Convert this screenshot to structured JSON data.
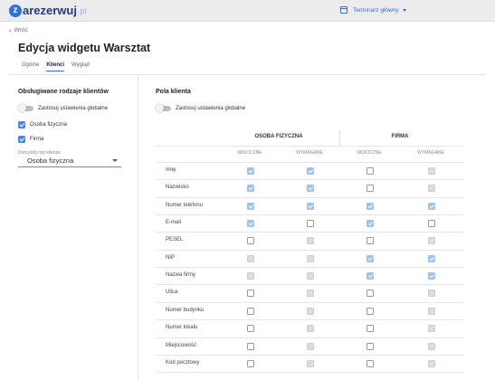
{
  "header": {
    "logo_letter": "z",
    "logo_text": "arezerwuj",
    "logo_tld": ".pl",
    "calendar_label": "Terminarz główny"
  },
  "back_label": "Wróć",
  "page_title": "Edycja widgetu Warsztat",
  "tabs": [
    {
      "label": "Ogólne",
      "active": false
    },
    {
      "label": "Klienci",
      "active": true
    },
    {
      "label": "Wygląd",
      "active": false
    }
  ],
  "left_panel": {
    "heading": "Obsługiwane rodzaje klientów",
    "global_toggle_label": "Zastosuj ustawienia globalne",
    "global_toggle_on": false,
    "client_types": [
      {
        "label": "Osoba fizyczna",
        "checked": true
      },
      {
        "label": "Firma",
        "checked": true
      }
    ],
    "default_type_label": "Domyślny typ klienta:",
    "default_type_value": "Osoba fizyczna"
  },
  "right_panel": {
    "heading": "Pola klienta",
    "global_toggle_label": "Zastosuj ustawienia globalne",
    "global_toggle_on": false,
    "groups": [
      "OSOBA FIZYCZNA",
      "FIRMA"
    ],
    "columns": [
      "WIDOCZNE",
      "WYMAGANE",
      "WIDOCZNE",
      "WYMAGANE"
    ],
    "rows": [
      {
        "label": "Imię",
        "states": [
          "dis-on",
          "dis-on",
          "off",
          "dis"
        ]
      },
      {
        "label": "Nazwisko",
        "states": [
          "dis-on",
          "dis-on",
          "off",
          "dis"
        ]
      },
      {
        "label": "Numer telefonu",
        "states": [
          "dis-on",
          "dis-on",
          "dis-on",
          "dis-on"
        ]
      },
      {
        "label": "E-mail",
        "states": [
          "dis-on",
          "off",
          "dis-on",
          "off"
        ]
      },
      {
        "label": "PESEL",
        "states": [
          "off",
          "dis",
          "off",
          "dis"
        ]
      },
      {
        "label": "NIP",
        "states": [
          "dis",
          "dis",
          "dis-on",
          "dis-on"
        ]
      },
      {
        "label": "Nazwa firmy",
        "states": [
          "dis",
          "dis",
          "dis-on",
          "dis-on"
        ]
      },
      {
        "label": "Ulica",
        "states": [
          "off",
          "dis",
          "off",
          "dis"
        ]
      },
      {
        "label": "Numer budynku",
        "states": [
          "off",
          "dis",
          "off",
          "dis"
        ]
      },
      {
        "label": "Numer lokalu",
        "states": [
          "off",
          "dis",
          "off",
          "dis"
        ]
      },
      {
        "label": "Miejscowość",
        "states": [
          "off",
          "dis",
          "off",
          "dis"
        ]
      },
      {
        "label": "Kod pocztowy",
        "states": [
          "off",
          "dis",
          "off",
          "dis"
        ]
      }
    ]
  },
  "colors": {
    "accent": "#2f6fe0",
    "checkbox_on": "#4a86e8",
    "checkbox_disabled_on": "#9ec0f2"
  }
}
